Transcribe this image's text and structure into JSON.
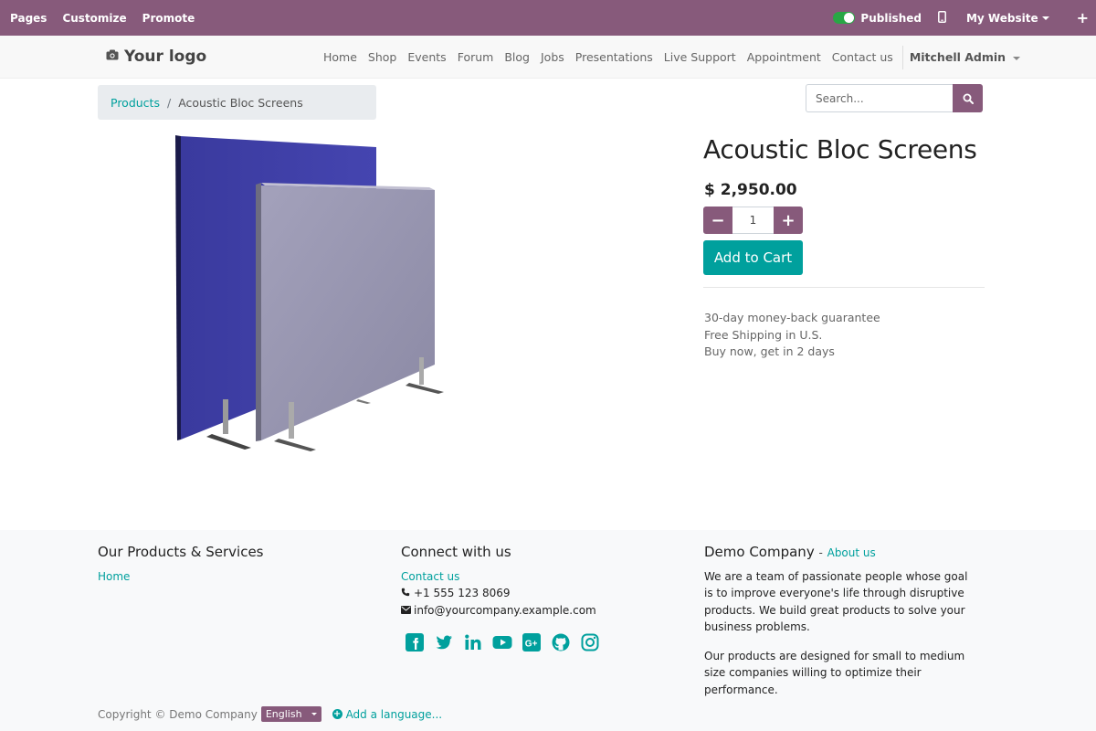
{
  "topbar": {
    "pages": "Pages",
    "customize": "Customize",
    "promote": "Promote",
    "published": "Published",
    "my_website": "My Website",
    "plus": "+"
  },
  "header": {
    "logo_text": "Your logo",
    "nav": [
      "Home",
      "Shop",
      "Events",
      "Forum",
      "Blog",
      "Jobs",
      "Presentations",
      "Live Support",
      "Appointment",
      "Contact us"
    ],
    "user": "Mitchell Admin"
  },
  "breadcrumb": {
    "parent": "Products",
    "separator": "/",
    "current": "Acoustic Bloc Screens"
  },
  "search": {
    "placeholder": "Search..."
  },
  "product": {
    "title": "Acoustic Bloc Screens",
    "price": "$ 2,950.00",
    "quantity": "1",
    "minus": "−",
    "plus": "+",
    "add_to_cart": "Add to Cart",
    "terms": [
      "30-day money-back guarantee",
      "Free Shipping in U.S.",
      "Buy now, get in 2 days"
    ]
  },
  "footer": {
    "col1": {
      "heading": "Our Products & Services",
      "link": "Home"
    },
    "col2": {
      "heading": "Connect with us",
      "contact": "Contact us",
      "phone": "+1 555 123 8069",
      "email": "info@yourcompany.example.com",
      "socials": [
        "facebook-icon",
        "twitter-icon",
        "linkedin-icon",
        "youtube-icon",
        "google-plus-icon",
        "github-icon",
        "instagram-icon"
      ]
    },
    "col3": {
      "heading": "Demo Company",
      "dash": "-",
      "about": "About us",
      "para1": "We are a team of passionate people whose goal is to improve everyone's life through disruptive products. We build great products to solve your business problems.",
      "para2": "Our products are designed for small to medium size companies willing to optimize their performance."
    },
    "copyright": "Copyright © Demo Company",
    "language": "English",
    "add_language": "Add a language..."
  },
  "colors": {
    "brand": "#875a7b",
    "accent": "#00a09d",
    "published_toggle": "#28a745"
  }
}
